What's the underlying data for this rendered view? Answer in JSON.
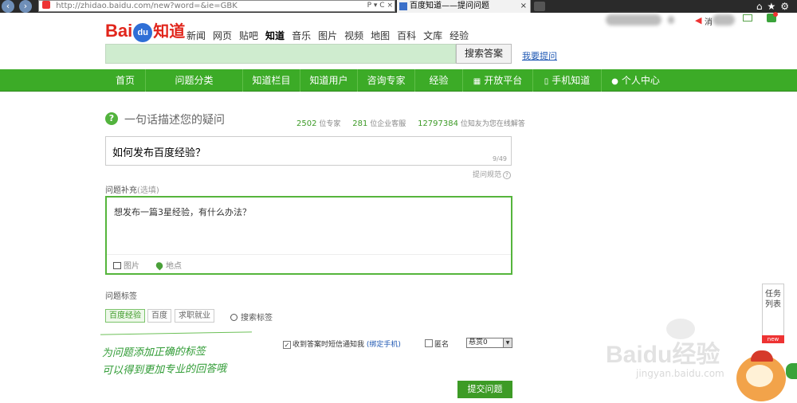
{
  "browser": {
    "url": "http://zhidao.baidu.com/new?word=&ie=GBK",
    "url_tools": "P ▾ C ×",
    "tab_title": "百度知道——提问问题",
    "tab_close": "×"
  },
  "logo": {
    "bai": "Bai",
    "du": "du",
    "zhidao": "知道"
  },
  "top_nav": [
    "新闻",
    "网页",
    "贴吧",
    "知道",
    "音乐",
    "图片",
    "视频",
    "地图",
    "百科",
    "文库",
    "经验"
  ],
  "top_nav_active": "知道",
  "user_area": {
    "msg_label": "消"
  },
  "search": {
    "value": "",
    "button": "搜索答案",
    "ask_link": "我要提问"
  },
  "green_nav": {
    "items": [
      "首页",
      "问题分类",
      "知道栏目",
      "知道用户",
      "咨询专家",
      "经验",
      "开放平台",
      "手机知道",
      "个人中心"
    ]
  },
  "question": {
    "title": "一句话描述您的疑问",
    "stats": {
      "experts_count": "2502",
      "experts_label": "位专家",
      "service_count": "281",
      "service_label": "位企业客服",
      "friends_count": "12797384",
      "friends_label": "位知友为您在线解答"
    },
    "input_value": "如何发布百度经验？",
    "count": "9/49",
    "guide": "提问规范"
  },
  "supplement": {
    "label": "问题补充",
    "optional": "(选填)",
    "value": "想发布一篇3星经验，有什么办法？",
    "image_tool": "图片",
    "location_tool": "地点"
  },
  "tags": {
    "label": "问题标签",
    "items": [
      "百度经验",
      "百度",
      "求职就业"
    ],
    "search": "搜索标签"
  },
  "annotation": {
    "line1": "为问题添加正确的标签",
    "line2": "可以得到更加专业的回答哦"
  },
  "options": {
    "sms_label": "收到答案时短信通知我",
    "bind_phone": "(绑定手机)",
    "anonymous": "匿名",
    "reward": "悬赏0",
    "sms_checked": "✓"
  },
  "submit": "提交问题",
  "task_list": {
    "label": "任务列表",
    "badge": "new"
  },
  "watermark": {
    "logo": "Baidu经验",
    "url": "jingyan.baidu.com"
  },
  "colors": {
    "brand_green": "#3cab27",
    "baidu_red": "#e1251b",
    "baidu_blue": "#2f6fd6",
    "link_blue": "#1f58b3"
  }
}
